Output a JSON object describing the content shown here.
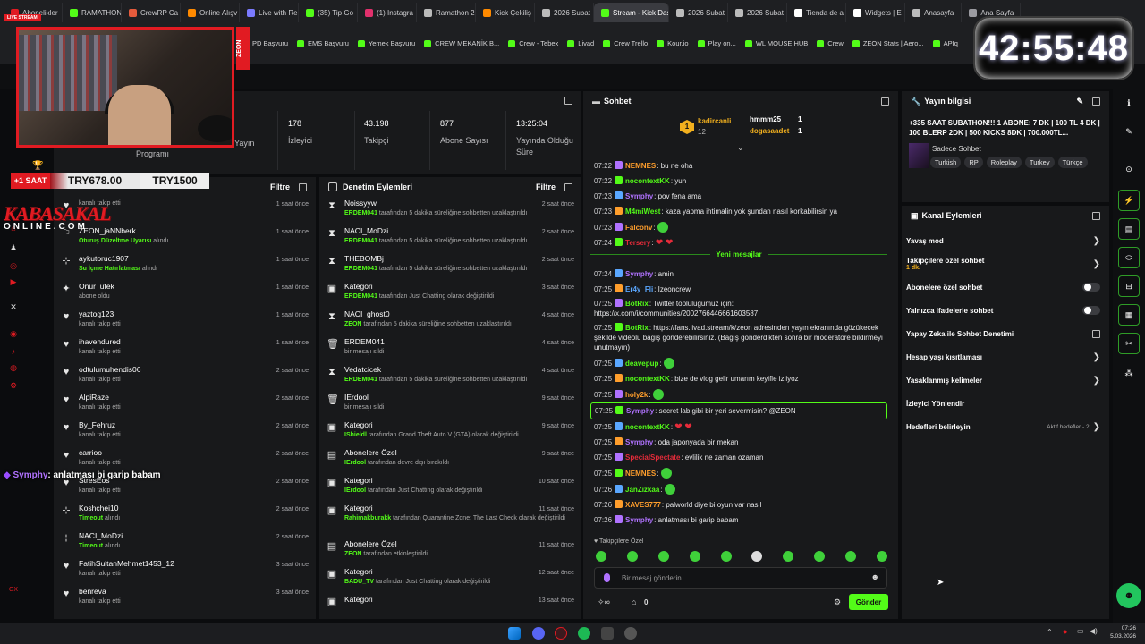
{
  "browser": {
    "tabs": [
      {
        "label": "Abonelikler",
        "color": "#e11b22"
      },
      {
        "label": "RAMATHON",
        "color": "#53fc18"
      },
      {
        "label": "CrewRP Ca",
        "color": "#e55b3c"
      },
      {
        "label": "Online Alışv",
        "color": "#ff8a00"
      },
      {
        "label": "Live with Re",
        "color": "#7b7bff"
      },
      {
        "label": "(35) Tip Go",
        "color": "#53fc18"
      },
      {
        "label": "(1) Instagra",
        "color": "#e1306c"
      },
      {
        "label": "Ramathon 2",
        "color": "#bbbbbb"
      },
      {
        "label": "Kick Çekiliş",
        "color": "#ff8a00"
      },
      {
        "label": "2026 Subat",
        "color": "#bbbbbb"
      },
      {
        "label": "Stream - Kick Dashb",
        "color": "#53fc18",
        "active": true
      },
      {
        "label": "2026 Subat",
        "color": "#bbbbbb"
      },
      {
        "label": "2026 Subat",
        "color": "#bbbbbb"
      },
      {
        "label": "Tienda de a",
        "color": "#ffffff"
      },
      {
        "label": "Widgets | E",
        "color": "#ffffff"
      },
      {
        "label": "Anasayfa",
        "color": "#bbbbbb"
      },
      {
        "label": "Ana Sayfa",
        "color": "#9a9aa0"
      }
    ],
    "bookmarks": [
      "PD Başvuru",
      "EMS Başvuru",
      "Yemek Başvuru",
      "CREW MEKANİK B...",
      "Crew - Tebex",
      "Livad",
      "Crew Trello",
      "Kour.io",
      "Play on...",
      "WL MOUSE HUB",
      "Crew",
      "ZEON Stats | Aero...",
      "APIq"
    ]
  },
  "overlay": {
    "live_label": "LIVE STREAM",
    "zeon": "ZEON",
    "timer": "42:55:48",
    "subs_label": "+1 SAAT",
    "goal_current": "TRY678.00",
    "goal_target": "TRY1500",
    "logo_top": "KABASAKAL",
    "logo_bottom": "ONLINE.COM",
    "chat_overlay_user": "Symphy",
    "chat_overlay_text": ": anlatması bi garip babam"
  },
  "stats": {
    "items": [
      {
        "value": "",
        "label": "Yayın"
      },
      {
        "value": "178",
        "label": "İzleyici"
      },
      {
        "value": "43.198",
        "label": "Takipçi"
      },
      {
        "value": "877",
        "label": "Abone Sayısı"
      },
      {
        "value": "13:25:04",
        "label": "Yayında Olduğu Süre"
      }
    ],
    "program": "Programı"
  },
  "activity": {
    "filter": "Filtre",
    "events": [
      {
        "icon": "heart-icon",
        "name": "",
        "sub": "kanalı takip etti",
        "time": "1 saat önce"
      },
      {
        "icon": "person-icon",
        "name": "ZEON_jaNNberk",
        "sub": "Oturuş Düzeltme Uyarısı",
        "subg": " alındı",
        "time": "1 saat önce"
      },
      {
        "icon": "redeem-icon",
        "name": "aykutoruc1907",
        "sub": "Su İçme Hatırlatması",
        "subg": " alındı",
        "time": "1 saat önce"
      },
      {
        "icon": "star-icon",
        "name": "OnurTufek",
        "sub": "abone oldu",
        "time": "1 saat önce"
      },
      {
        "icon": "heart-icon",
        "name": "yaztog123",
        "sub": "kanalı takip etti",
        "time": "1 saat önce"
      },
      {
        "icon": "heart-icon",
        "name": "ihavendured",
        "sub": "kanalı takip etti",
        "time": "1 saat önce"
      },
      {
        "icon": "heart-icon",
        "name": "odtulumuhendis06",
        "sub": "kanalı takip etti",
        "time": "2 saat önce"
      },
      {
        "icon": "heart-icon",
        "name": "AlpiRaze",
        "sub": "kanalı takip etti",
        "time": "2 saat önce"
      },
      {
        "icon": "heart-icon",
        "name": "By_Fehruz",
        "sub": "kanalı takip etti",
        "time": "2 saat önce"
      },
      {
        "icon": "heart-icon",
        "name": "carrioo",
        "sub": "kanalı takip etti",
        "time": "2 saat önce"
      },
      {
        "icon": "heart-icon",
        "name": "StresEos",
        "sub": "kanalı takip etti",
        "time": "2 saat önce"
      },
      {
        "icon": "redeem-icon",
        "name": "Koshchei10",
        "sub": "Timeout",
        "subg": " alındı",
        "time": "2 saat önce"
      },
      {
        "icon": "redeem-icon",
        "name": "NACI_MoDzi",
        "sub": "Timeout",
        "subg": " alındı",
        "time": "2 saat önce"
      },
      {
        "icon": "heart-icon",
        "name": "FatihSultanMehmet1453_12",
        "sub": "kanalı takip etti",
        "time": "3 saat önce"
      },
      {
        "icon": "heart-icon",
        "name": "benreva",
        "sub": "kanalı takip etti",
        "time": "3 saat önce"
      }
    ]
  },
  "moderation": {
    "title": "Denetim Eylemleri",
    "filter": "Filtre",
    "events": [
      {
        "icon": "hourglass-icon",
        "name": "Noissyyw",
        "g": "ERDEM041",
        "rest": " tarafından 5 dakika süreliğine sohbetten uzaklaştırıldı",
        "time": "2 saat önce"
      },
      {
        "icon": "hourglass-icon",
        "name": "NACI_MoDzi",
        "g": "ERDEM041",
        "rest": " tarafından 5 dakika süreliğine sohbetten uzaklaştırıldı",
        "time": "2 saat önce"
      },
      {
        "icon": "hourglass-icon",
        "name": "THEBOMBj",
        "g": "ERDEM041",
        "rest": " tarafından 5 dakika süreliğine sohbetten uzaklaştırıldı",
        "time": "2 saat önce"
      },
      {
        "icon": "category-icon",
        "name": "Kategori",
        "g": "ERDEM041",
        "rest": " tarafından Just Chatting olarak değiştirildi",
        "time": "3 saat önce"
      },
      {
        "icon": "hourglass-icon",
        "name": "NACI_ghost0",
        "g": "ZEON",
        "rest": " tarafından 5 dakika süreliğine sohbetten uzaklaştırıldı",
        "time": "4 saat önce"
      },
      {
        "icon": "trash-icon",
        "name": "ERDEM041",
        "g": "",
        "rest": "bir mesajı sildi",
        "time": "4 saat önce"
      },
      {
        "icon": "hourglass-icon",
        "name": "Vedatcicek",
        "g": "ERDEM041",
        "rest": " tarafından 5 dakika süreliğine sohbetten uzaklaştırıldı",
        "time": "4 saat önce"
      },
      {
        "icon": "trash-icon",
        "name": "IErdool",
        "g": "",
        "rest": "bir mesajı sildi",
        "time": "9 saat önce"
      },
      {
        "icon": "category-icon",
        "name": "Kategori",
        "g": "IShieldl",
        "rest": " tarafından Grand Theft Auto V (GTA) olarak değiştirildi",
        "time": "9 saat önce"
      },
      {
        "icon": "store-icon",
        "name": "Abonelere Özel",
        "g": "IErdool",
        "rest": " tarafından devre dışı bırakıldı",
        "time": "9 saat önce"
      },
      {
        "icon": "category-icon",
        "name": "Kategori",
        "g": "IErdool",
        "rest": " tarafından Just Chatting olarak değiştirildi",
        "time": "10 saat önce"
      },
      {
        "icon": "category-icon",
        "name": "Kategori",
        "g": "Rahimakburakk",
        "rest": " tarafından Quarantine Zone: The Last Check olarak değiştirildi",
        "time": "11 saat önce"
      },
      {
        "icon": "store-icon",
        "name": "Abonelere Özel",
        "g": "ZEON",
        "rest": " tarafından etkinleştirildi",
        "time": "11 saat önce"
      },
      {
        "icon": "category-icon",
        "name": "Kategori",
        "g": "BADU_TV",
        "rest": " tarafından Just Chatting olarak değiştirildi",
        "time": "12 saat önce"
      },
      {
        "icon": "category-icon",
        "name": "Kategori",
        "g": "",
        "rest": "",
        "time": "13 saat önce"
      }
    ]
  },
  "chat": {
    "title": "Sohbet",
    "top": [
      {
        "rank": "1",
        "name": "kadircanli",
        "count": "12"
      },
      {
        "name": "hmmm25",
        "count": "1"
      },
      {
        "name": "dogasaadet",
        "count": "1"
      }
    ],
    "messages": [
      {
        "t": "07:22",
        "u": "NEMNES",
        "c": "#ff9e2c",
        "m": "bu ne oha"
      },
      {
        "t": "07:22",
        "u": "nocontextKK",
        "c": "#53fc18",
        "m": "yuh"
      },
      {
        "t": "07:23",
        "u": "Symphy",
        "c": "#b072ff",
        "m": "pov fena ama"
      },
      {
        "t": "07:23",
        "u": "M4miWest",
        "c": "#53fc18",
        "m": "kaza yapma ihtimalin yok şundan nasıl korkabilirsin ya"
      },
      {
        "t": "07:23",
        "u": "Falconv",
        "c": "#ff9e2c",
        "m": ""
      },
      {
        "t": "07:24",
        "u": "Tersery",
        "c": "#e52b3a",
        "m": ""
      },
      {
        "t": "07:24",
        "u": "Symphy",
        "c": "#b072ff",
        "m": "amin"
      },
      {
        "t": "07:25",
        "u": "Er4y_Fli",
        "c": "#5aa7ff",
        "m": "Izeoncrew"
      },
      {
        "t": "07:25",
        "u": "BotRix",
        "c": "#53fc18",
        "m": "Twitter topluluğumuz için: https://x.com/i/communities/2002766446661603587"
      },
      {
        "t": "07:25",
        "u": "BotRix",
        "c": "#53fc18",
        "m": "https://fans.livad.stream/k/zeon adresinden yayın ekranında gözükecek şekilde videolu bağış gönderebilirsiniz. (Bağış gönderdikten sonra bir moderatöre bildirmeyi unutmayın)"
      },
      {
        "t": "07:25",
        "u": "deavepup",
        "c": "#53fc18",
        "m": ""
      },
      {
        "t": "07:25",
        "u": "nocontextKK",
        "c": "#53fc18",
        "m": "bize de vlog gelir umarım keyifle izliyoz"
      },
      {
        "t": "07:25",
        "u": "holy2k",
        "c": "#ff9e2c",
        "m": ""
      },
      {
        "t": "07:25",
        "u": "Symphy",
        "c": "#b072ff",
        "m": "secret lab gibi bir yeri severmisin? @ZEON"
      },
      {
        "t": "07:25",
        "u": "nocontextKK",
        "c": "#53fc18",
        "m": ""
      },
      {
        "t": "07:25",
        "u": "Symphy",
        "c": "#b072ff",
        "m": "oda japonyada bir mekan"
      },
      {
        "t": "07:25",
        "u": "SpecialSpectate",
        "c": "#e52b3a",
        "m": "evlilik ne zaman ozaman"
      },
      {
        "t": "07:25",
        "u": "NEMNES",
        "c": "#ff9e2c",
        "m": ""
      },
      {
        "t": "07:26",
        "u": "JanZizkaa",
        "c": "#53fc18",
        "m": ""
      },
      {
        "t": "07:26",
        "u": "XAVES777",
        "c": "#ff9e2c",
        "m": "palworld diye bi oyun var nasıl"
      },
      {
        "t": "07:26",
        "u": "Symphy",
        "c": "#b072ff",
        "m": "anlatması bi garip babam"
      }
    ],
    "new_messages": "Yeni mesajlar",
    "followers_only": "Takipçilere Özel",
    "input_placeholder": "Bir mesaj gönderin",
    "points": "0",
    "send": "Gönder"
  },
  "stream_info": {
    "title": "Yayın bilgisi",
    "text": "+335 SAAT SUBATHON!!! 1 ABONE: 7 DK | 100 TL 4 DK | 100 BLERP 2DK | 500 KICKS 8DK | 700.000TL...",
    "category": "Sadece Sohbet",
    "tags": [
      "Turkish",
      "RP",
      "Roleplay",
      "Turkey",
      "Türkçe"
    ]
  },
  "channel_actions": {
    "title": "Kanal Eylemleri",
    "items": [
      {
        "label": "Yavaş mod",
        "kind": "chevron"
      },
      {
        "label": "Takipçilere özel sohbet",
        "sub": "1 dk.",
        "kind": "chevron"
      },
      {
        "label": "Abonelere özel sohbet",
        "kind": "toggle"
      },
      {
        "label": "Yalnızca ifadelerle sohbet",
        "kind": "toggle"
      },
      {
        "label": "Yapay Zeka ile Sohbet Denetimi",
        "kind": "ext"
      },
      {
        "label": "Hesap yaşı kısıtlaması",
        "kind": "chevron"
      },
      {
        "label": "Yasaklanmış kelimeler",
        "kind": "chevron"
      },
      {
        "label": "İzleyici Yönlendir",
        "kind": "none"
      },
      {
        "label": "Hedefleri belirleyin",
        "kind": "chevron",
        "extra": "Aktif hedefler - 2"
      }
    ]
  },
  "taskbar": {
    "time": "07:26",
    "date": "5.03.2026"
  }
}
